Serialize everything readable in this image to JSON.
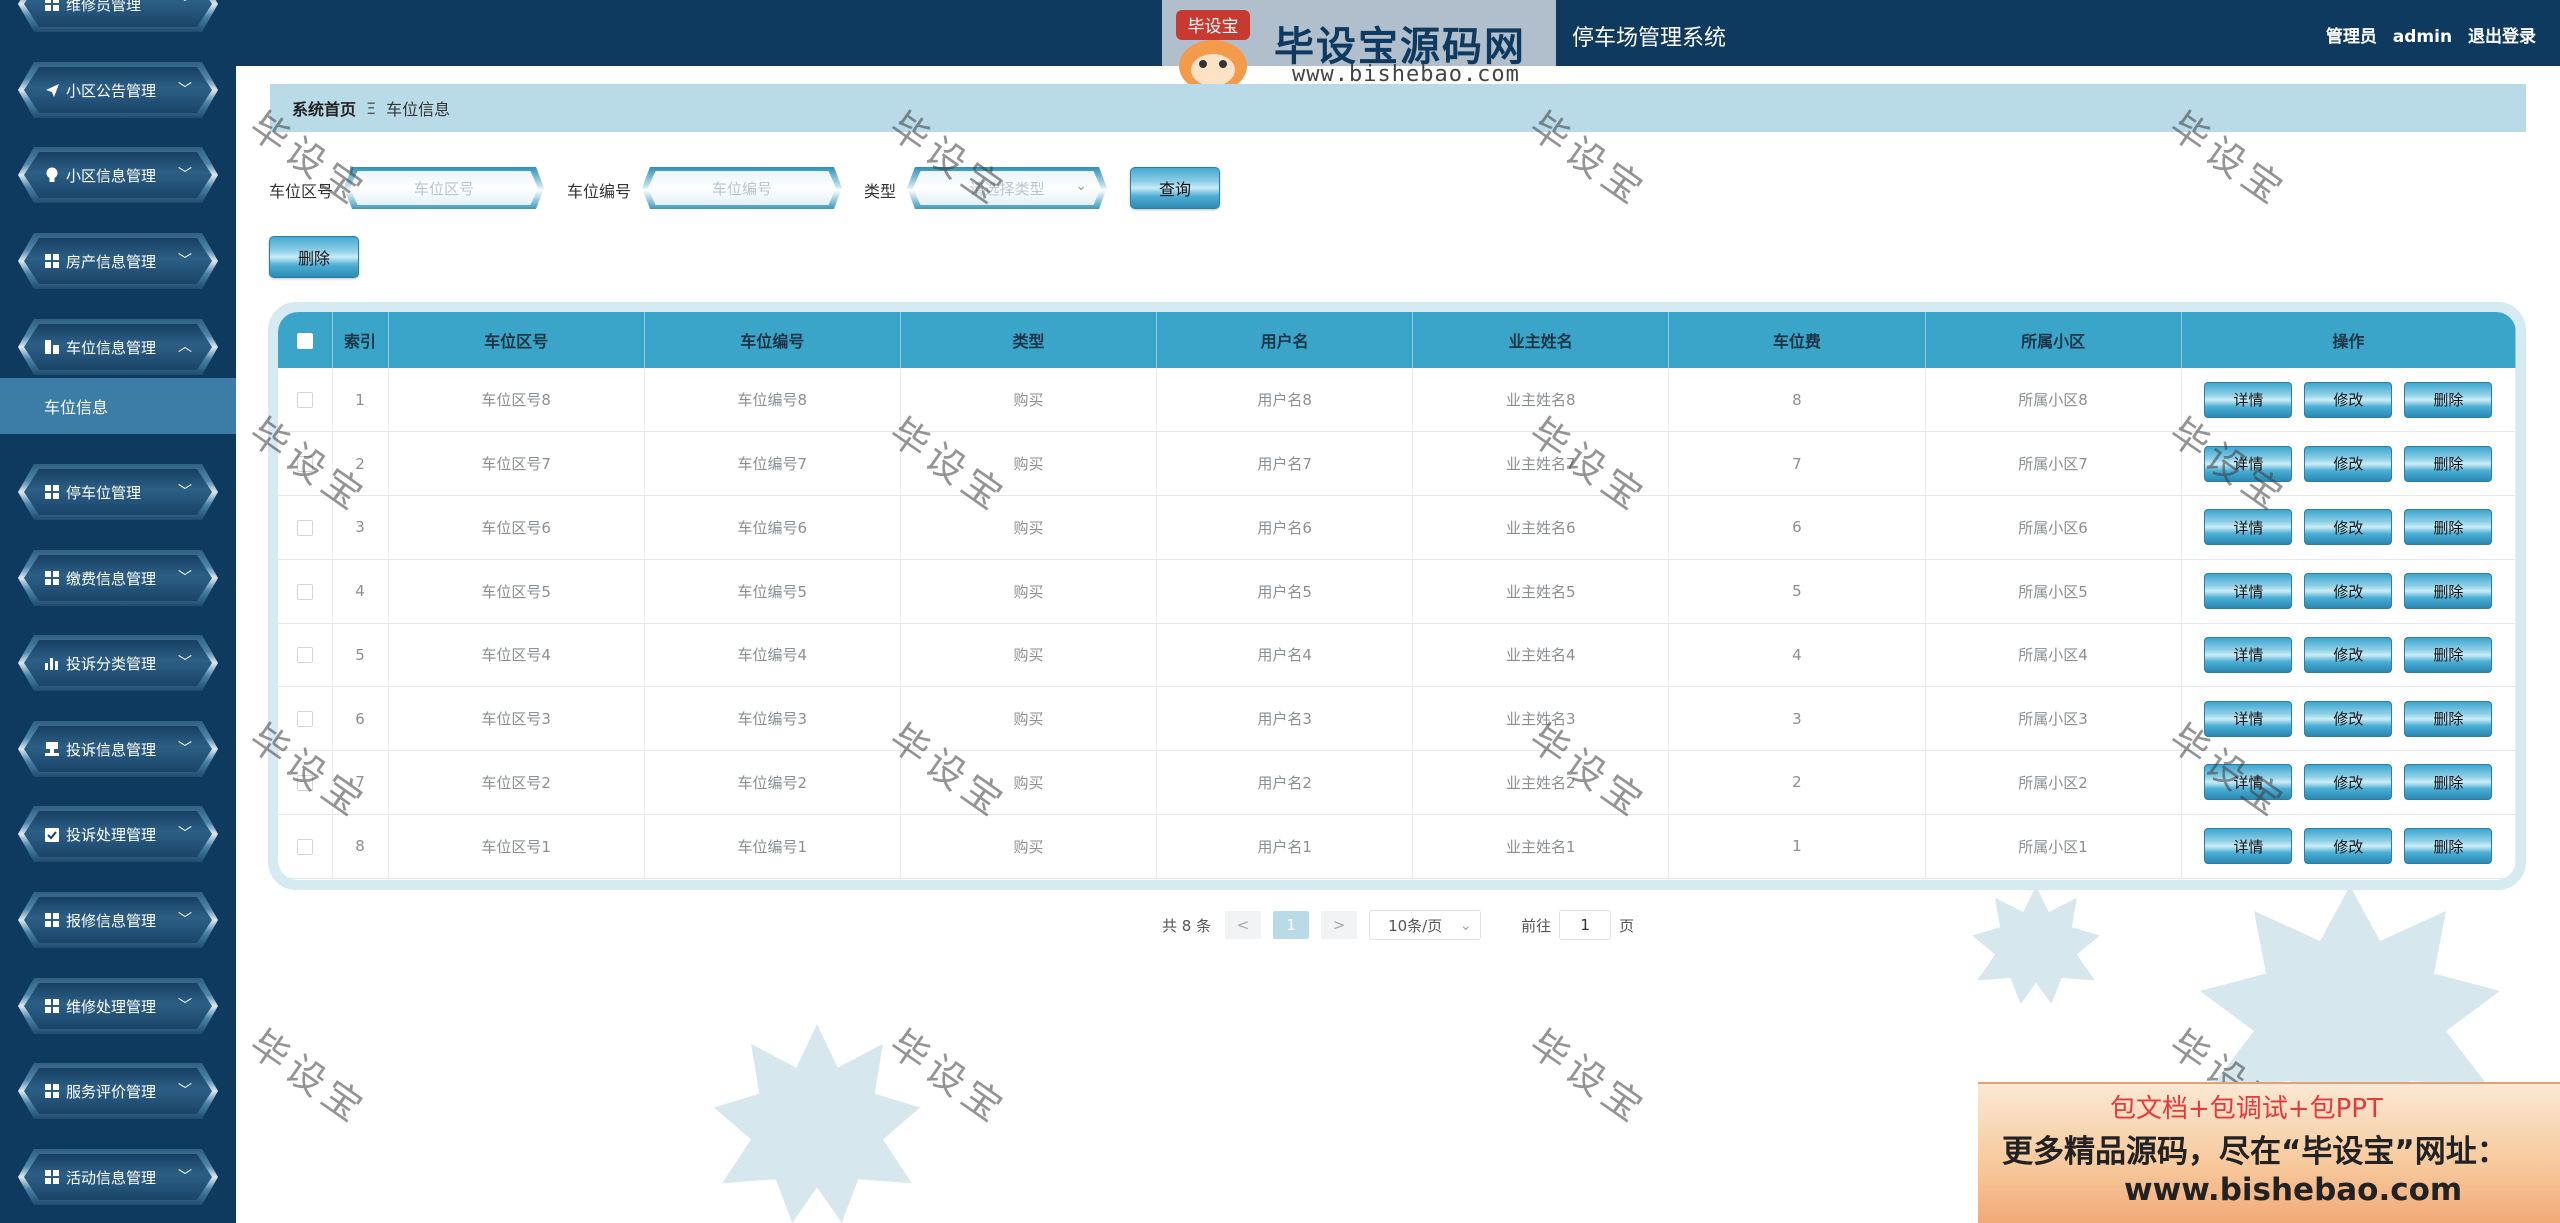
{
  "header": {
    "site_title": "停车场管理系统",
    "user_role": "管理员",
    "user_name": "admin",
    "logout_label": "退出登录"
  },
  "logo": {
    "badge_text": "毕设宝",
    "brand": "毕设宝源码网",
    "url": "www.bishebao.com"
  },
  "sidebar": {
    "items": [
      {
        "label": "维修员管理",
        "icon": "grid-icon"
      },
      {
        "label": "小区公告管理",
        "icon": "send-icon"
      },
      {
        "label": "小区信息管理",
        "icon": "bulb-icon"
      },
      {
        "label": "房产信息管理",
        "icon": "grid-icon"
      },
      {
        "label": "车位信息管理",
        "icon": "building-icon"
      },
      {
        "label": "停车位管理",
        "icon": "grid-icon"
      },
      {
        "label": "缴费信息管理",
        "icon": "grid-icon"
      },
      {
        "label": "投诉分类管理",
        "icon": "bar-chart-icon"
      },
      {
        "label": "投诉信息管理",
        "icon": "stamp-icon"
      },
      {
        "label": "投诉处理管理",
        "icon": "clipboard-check-icon"
      },
      {
        "label": "报修信息管理",
        "icon": "grid-icon"
      },
      {
        "label": "维修处理管理",
        "icon": "grid-icon"
      },
      {
        "label": "服务评价管理",
        "icon": "grid-icon"
      },
      {
        "label": "活动信息管理",
        "icon": "grid-icon"
      }
    ],
    "active_sub": "车位信息"
  },
  "breadcrumb": {
    "home": "系统首页",
    "separator": "Ξ",
    "current": "车位信息"
  },
  "search": {
    "zone_label": "车位区号",
    "zone_placeholder": "车位区号",
    "number_label": "车位编号",
    "number_placeholder": "车位编号",
    "type_label": "类型",
    "type_placeholder": "请选择类型",
    "query_button": "查询",
    "delete_button": "删除"
  },
  "table": {
    "columns": [
      "索引",
      "车位区号",
      "车位编号",
      "类型",
      "用户名",
      "业主姓名",
      "车位费",
      "所属小区",
      "操作"
    ],
    "rows": [
      {
        "index": "1",
        "zone": "车位区号8",
        "number": "车位编号8",
        "type": "购买",
        "username": "用户名8",
        "owner": "业主姓名8",
        "fee": "8",
        "community": "所属小区8"
      },
      {
        "index": "2",
        "zone": "车位区号7",
        "number": "车位编号7",
        "type": "购买",
        "username": "用户名7",
        "owner": "业主姓名7",
        "fee": "7",
        "community": "所属小区7"
      },
      {
        "index": "3",
        "zone": "车位区号6",
        "number": "车位编号6",
        "type": "购买",
        "username": "用户名6",
        "owner": "业主姓名6",
        "fee": "6",
        "community": "所属小区6"
      },
      {
        "index": "4",
        "zone": "车位区号5",
        "number": "车位编号5",
        "type": "购买",
        "username": "用户名5",
        "owner": "业主姓名5",
        "fee": "5",
        "community": "所属小区5"
      },
      {
        "index": "5",
        "zone": "车位区号4",
        "number": "车位编号4",
        "type": "购买",
        "username": "用户名4",
        "owner": "业主姓名4",
        "fee": "4",
        "community": "所属小区4"
      },
      {
        "index": "6",
        "zone": "车位区号3",
        "number": "车位编号3",
        "type": "购买",
        "username": "用户名3",
        "owner": "业主姓名3",
        "fee": "3",
        "community": "所属小区3"
      },
      {
        "index": "7",
        "zone": "车位区号2",
        "number": "车位编号2",
        "type": "购买",
        "username": "用户名2",
        "owner": "业主姓名2",
        "fee": "2",
        "community": "所属小区2"
      },
      {
        "index": "8",
        "zone": "车位区号1",
        "number": "车位编号1",
        "type": "购买",
        "username": "用户名1",
        "owner": "业主姓名1",
        "fee": "1",
        "community": "所属小区1"
      }
    ],
    "op_detail": "详情",
    "op_edit": "修改",
    "op_delete": "删除"
  },
  "pagination": {
    "total_text": "共 8 条",
    "prev": "<",
    "current_page": "1",
    "next": ">",
    "page_size": "10条/页",
    "goto_label": "前往",
    "goto_value": "1",
    "page_suffix": "页"
  },
  "watermark": {
    "text": "毕设宝"
  },
  "ad": {
    "line1": "包文档+包调试+包PPT",
    "line2": "更多精品源码，尽在“毕设宝”网址：",
    "line3": "www.bishebao.com"
  },
  "colors": {
    "sidebar_bg": "#0f3a60",
    "header_bg": "#0f3a60",
    "table_header": "#3aa5c9",
    "breadcrumb_bg": "#b8dbe7",
    "active_sub": "#3c7da7"
  }
}
